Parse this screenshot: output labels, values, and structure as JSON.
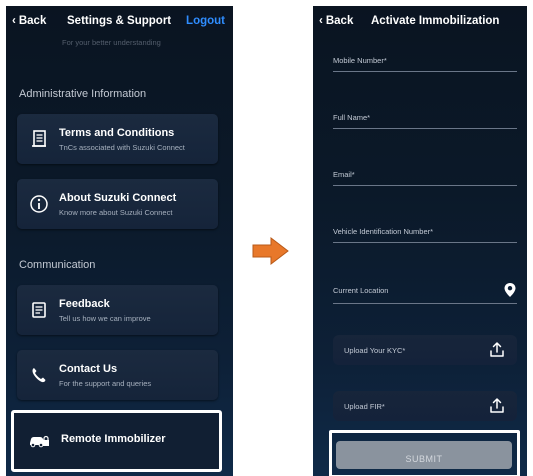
{
  "left_screen": {
    "back_label": "Back",
    "title": "Settings & Support",
    "logout_label": "Logout",
    "faded_text": "For your better understanding",
    "section_admin": "Administrative Information",
    "section_comm": "Communication",
    "cards": [
      {
        "title": "Terms and Conditions",
        "subtitle": "TnCs associated with Suzuki Connect",
        "icon": "document-icon"
      },
      {
        "title": "About Suzuki Connect",
        "subtitle": "Know more about Suzuki Connect",
        "icon": "info-icon"
      },
      {
        "title": "Feedback",
        "subtitle": "Tell us how we can improve",
        "icon": "feedback-icon"
      },
      {
        "title": "Contact Us",
        "subtitle": "For the support and queries",
        "icon": "phone-icon"
      },
      {
        "title": "Remote Immobilizer",
        "subtitle": "",
        "icon": "car-lock-icon"
      }
    ]
  },
  "arrow": {
    "icon": "right-arrow-icon",
    "color": "#e8782a"
  },
  "right_screen": {
    "back_label": "Back",
    "title": "Activate Immobilization",
    "fields": [
      {
        "label": "Mobile Number*"
      },
      {
        "label": "Full Name*"
      },
      {
        "label": "Email*"
      },
      {
        "label": "Vehicle Identification Number*"
      },
      {
        "label": "Current Location",
        "icon": "location-pin-icon"
      }
    ],
    "uploads": [
      {
        "label": "Upload Your KYC*",
        "icon": "upload-icon"
      },
      {
        "label": "Upload FIR*",
        "icon": "upload-icon"
      }
    ],
    "submit_label": "SUBMIT"
  },
  "colors": {
    "accent_blue": "#2f8dff",
    "highlight": "#ffffff",
    "arrow_orange": "#e8782a"
  }
}
